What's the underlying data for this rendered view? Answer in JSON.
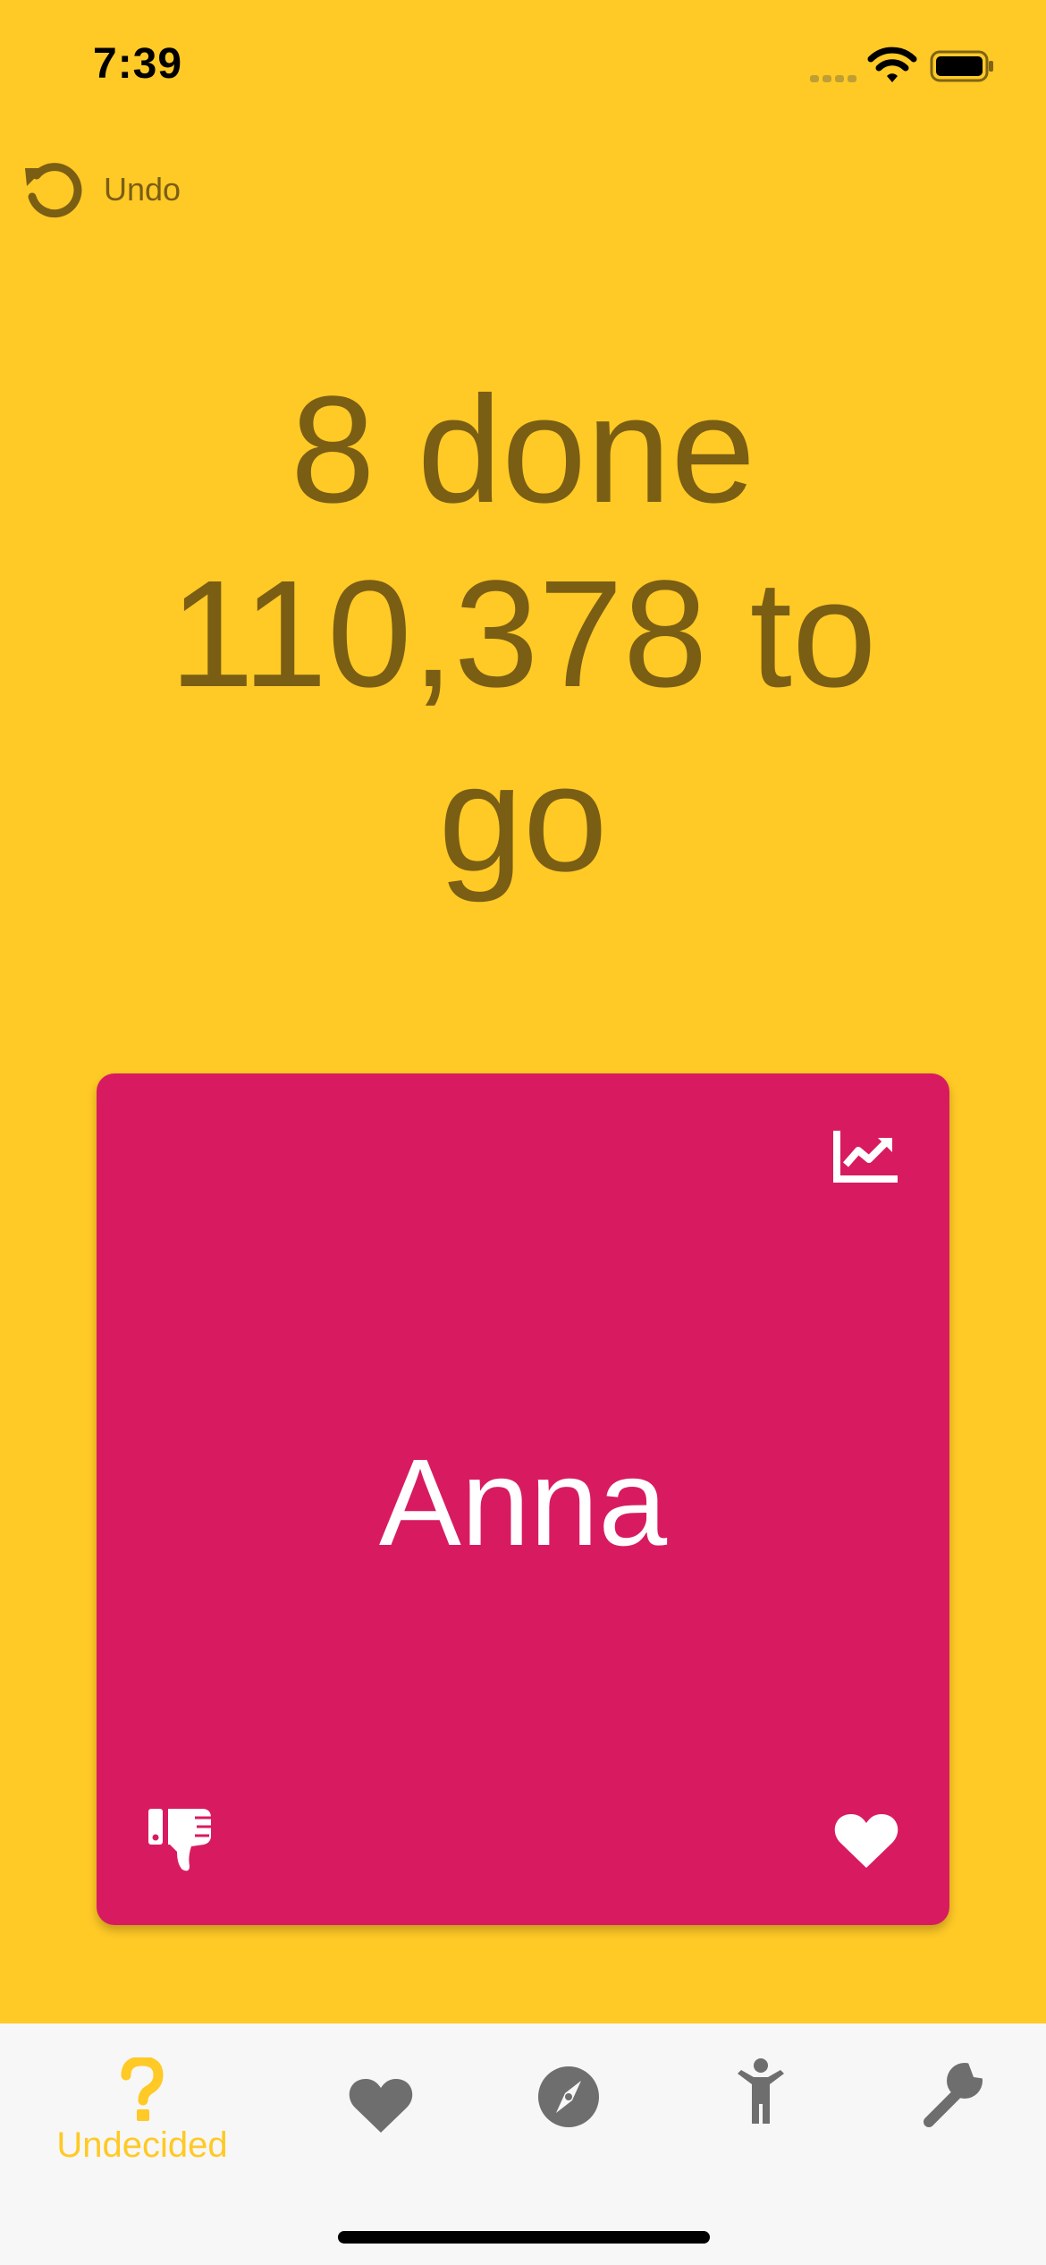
{
  "status_bar": {
    "time": "7:39"
  },
  "toolbar": {
    "undo_label": "Undo"
  },
  "progress": {
    "done_text": "8 done",
    "to_go_line1": "110,378 to",
    "to_go_line2": "go"
  },
  "card": {
    "name": "Anna",
    "background": "#D81B60"
  },
  "tabs": [
    {
      "label": "Undecided",
      "icon": "question-icon",
      "active": true
    },
    {
      "label": "",
      "icon": "heart-icon",
      "active": false
    },
    {
      "label": "",
      "icon": "compass-icon",
      "active": false
    },
    {
      "label": "",
      "icon": "child-icon",
      "active": false
    },
    {
      "label": "",
      "icon": "wrench-icon",
      "active": false
    }
  ],
  "colors": {
    "background": "#FFC926",
    "text_dark": "#7A5E14",
    "card": "#D81B60",
    "tab_inactive": "#6E6E6E",
    "tab_active": "#FFC926",
    "tabbar_bg": "#F7F7F7"
  }
}
